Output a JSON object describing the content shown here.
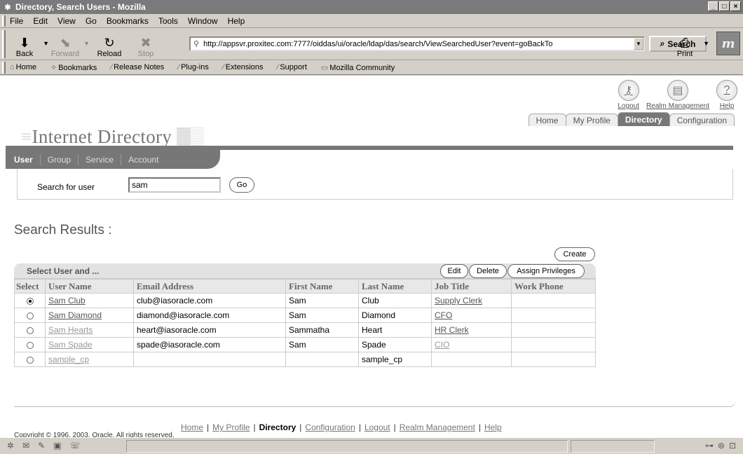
{
  "window": {
    "title": "Directory, Search Users - Mozilla",
    "controls": [
      "_",
      "□",
      "×"
    ]
  },
  "menu": [
    "File",
    "Edit",
    "View",
    "Go",
    "Bookmarks",
    "Tools",
    "Window",
    "Help"
  ],
  "nav": {
    "back": "Back",
    "forward": "Forward",
    "reload": "Reload",
    "stop": "Stop",
    "url": "http://appsvr.proxitec.com:7777/oiddas/ui/oracle/ldap/das/search/ViewSearchedUser?event=goBackTo",
    "search": "Search",
    "print": "Print"
  },
  "bookmarks": [
    "Home",
    "Bookmarks",
    "Release Notes",
    "Plug-ins",
    "Extensions",
    "Support",
    "Mozilla Community"
  ],
  "app": {
    "logo": "Internet Directory",
    "global": {
      "logout": "Logout",
      "realm": "Realm Management",
      "help": "Help"
    },
    "tabs": [
      "Home",
      "My Profile",
      "Directory",
      "Configuration"
    ],
    "subtabs": [
      "User",
      "Group",
      "Service",
      "Account"
    ]
  },
  "search": {
    "label": "Search for user",
    "value": "sam",
    "go": "Go"
  },
  "results": {
    "title": "Search Results :",
    "create": "Create",
    "bar_label": "Select User and ...",
    "actions": {
      "edit": "Edit",
      "delete": "Delete",
      "assign": "Assign Privileges"
    },
    "columns": [
      "Select",
      "User Name",
      "Email Address",
      "First Name",
      "Last Name",
      "Job Title",
      "Work Phone"
    ],
    "rows": [
      {
        "selected": true,
        "user": "Sam Club",
        "email": "club@iasoracle.com",
        "first": "Sam",
        "last": "Club",
        "job": "Supply Clerk",
        "phone": ""
      },
      {
        "selected": false,
        "user": "Sam Diamond",
        "email": "diamond@iasoracle.com",
        "first": "Sam",
        "last": "Diamond",
        "job": "CFO",
        "phone": ""
      },
      {
        "selected": false,
        "user": "Sam Hearts",
        "email": "heart@iasoracle.com",
        "first": "Sammatha",
        "last": "Heart",
        "job": "HR Clerk",
        "phone": ""
      },
      {
        "selected": false,
        "user": "Sam Spade",
        "email": "spade@iasoracle.com",
        "first": "Sam",
        "last": "Spade",
        "job": "CIO",
        "phone": ""
      },
      {
        "selected": false,
        "user": "sample_cp",
        "email": "",
        "first": "",
        "last": "sample_cp",
        "job": "",
        "phone": ""
      }
    ]
  },
  "footer": {
    "links": [
      "Home",
      "My Profile",
      "Directory",
      "Configuration",
      "Logout",
      "Realm Management",
      "Help"
    ],
    "copyright": "Copyright © 1996, 2003, Oracle. All rights reserved."
  }
}
